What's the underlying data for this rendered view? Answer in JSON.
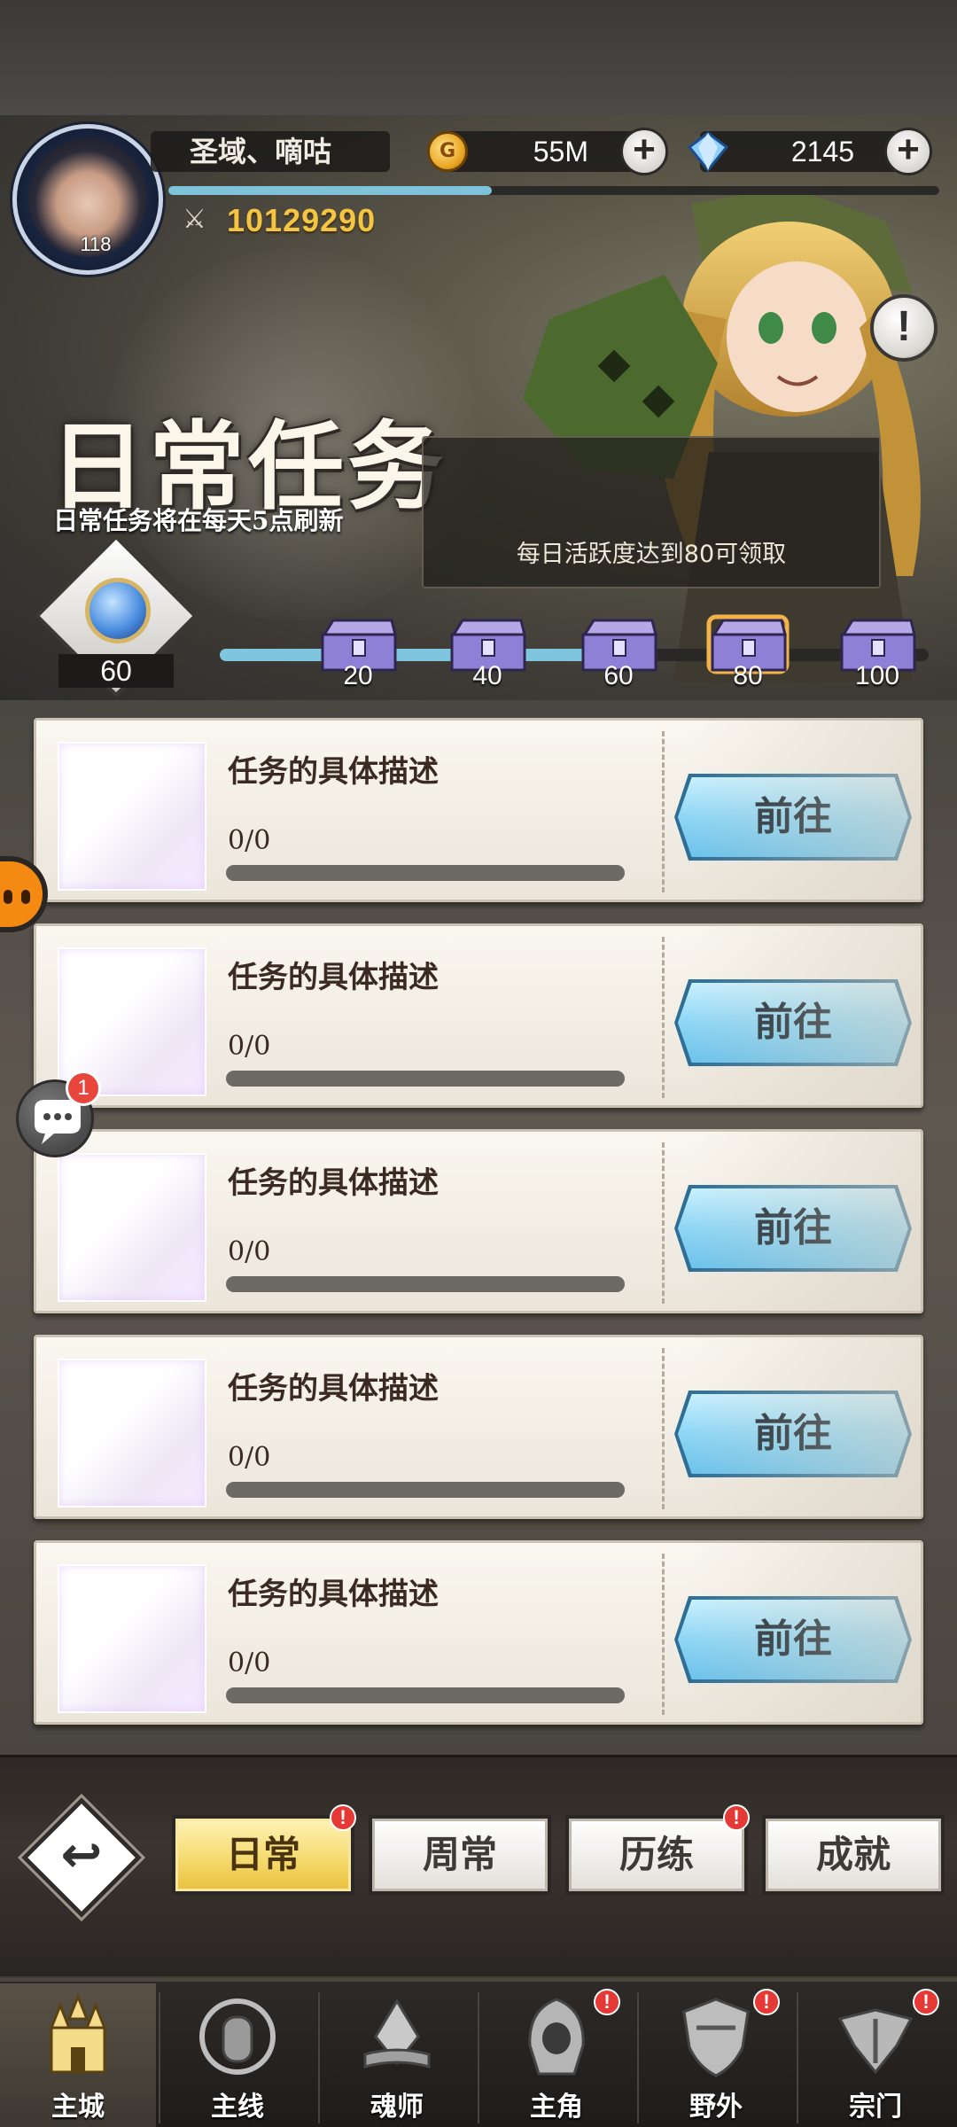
{
  "player": {
    "name": "圣域、嘀咕",
    "level": "118",
    "power": "10129290",
    "xp_progress": 0.42
  },
  "currency": {
    "gold": "55M",
    "gems": "2145"
  },
  "banner": {
    "title": "日常任务",
    "subtitle": "日常任务将在每天5点刷新",
    "tip": "每日活跃度达到80可领取"
  },
  "activity": {
    "value": "60",
    "progress": 0.6,
    "milestones": [
      "20",
      "40",
      "60",
      "80",
      "100"
    ],
    "highlighted_milestone": "80"
  },
  "tasks": [
    {
      "desc": "任务的具体描述",
      "count": "0/0",
      "button": "前往"
    },
    {
      "desc": "任务的具体描述",
      "count": "0/0",
      "button": "前往"
    },
    {
      "desc": "任务的具体描述",
      "count": "0/0",
      "button": "前往"
    },
    {
      "desc": "任务的具体描述",
      "count": "0/0",
      "button": "前往"
    },
    {
      "desc": "任务的具体描述",
      "count": "0/0",
      "button": "前往"
    }
  ],
  "chat_badge": "1",
  "tabs": [
    {
      "label": "日常",
      "active": true,
      "alert": true
    },
    {
      "label": "周常",
      "active": false,
      "alert": false
    },
    {
      "label": "历练",
      "active": false,
      "alert": true
    },
    {
      "label": "成就",
      "active": false,
      "alert": false
    }
  ],
  "alert_mark": "!",
  "nav": [
    {
      "label": "主城",
      "icon": "castle-icon",
      "active": true,
      "alert": false
    },
    {
      "label": "主线",
      "icon": "shield-gate-icon",
      "active": false,
      "alert": false
    },
    {
      "label": "魂师",
      "icon": "book-crystal-icon",
      "active": false,
      "alert": false
    },
    {
      "label": "主角",
      "icon": "hooded-figure-icon",
      "active": false,
      "alert": true
    },
    {
      "label": "野外",
      "icon": "crest-shield-icon",
      "active": false,
      "alert": true
    },
    {
      "label": "宗门",
      "icon": "winged-emblem-icon",
      "active": false,
      "alert": true
    }
  ],
  "colors": {
    "accent_blue": "#7fc5dd",
    "power_gold": "#f4c542",
    "alert_red": "#e53935",
    "active_tab": "#f4d86a"
  }
}
